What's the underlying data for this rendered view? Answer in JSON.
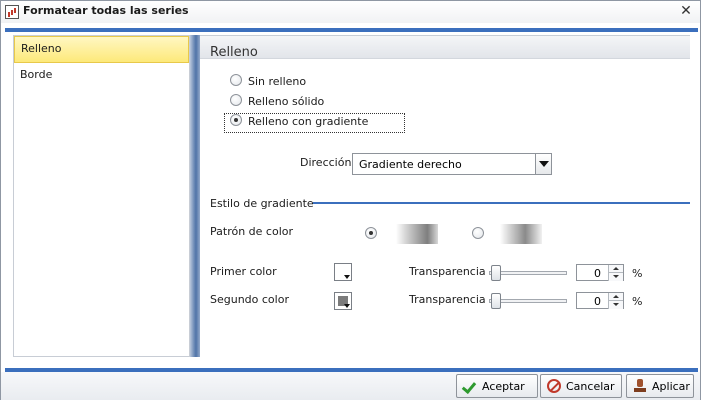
{
  "window": {
    "title": "Formatear todas las series"
  },
  "sidebar": {
    "items": [
      {
        "label": "Relleno"
      },
      {
        "label": "Borde"
      }
    ]
  },
  "main": {
    "section_title": "Relleno",
    "fill_options": [
      {
        "label": "Sin relleno"
      },
      {
        "label": "Relleno sólido"
      },
      {
        "label": "Relleno con gradiente"
      }
    ],
    "direction_label": "Dirección",
    "direction_value": "Gradiente derecho",
    "gradient_style_label": "Estilo de gradiente",
    "color_pattern_label": "Patrón de color",
    "first_color_label": "Primer color",
    "second_color_label": "Segundo color",
    "transparency_label_1": "Transparencia",
    "transparency_label_2": "Transparencia",
    "transparency_value_1": "0",
    "transparency_value_2": "0",
    "percent_1": "%",
    "percent_2": "%"
  },
  "footer": {
    "ok_label": "Aceptar",
    "cancel_label": "Cancelar",
    "apply_label": "Aplicar"
  },
  "colors": {
    "accent": "#3b6fbd",
    "selection": "#fde97a"
  },
  "icons": {
    "ok": "check-icon",
    "cancel": "cancel-icon",
    "apply": "apply-stamp-icon",
    "close": "close-icon"
  }
}
